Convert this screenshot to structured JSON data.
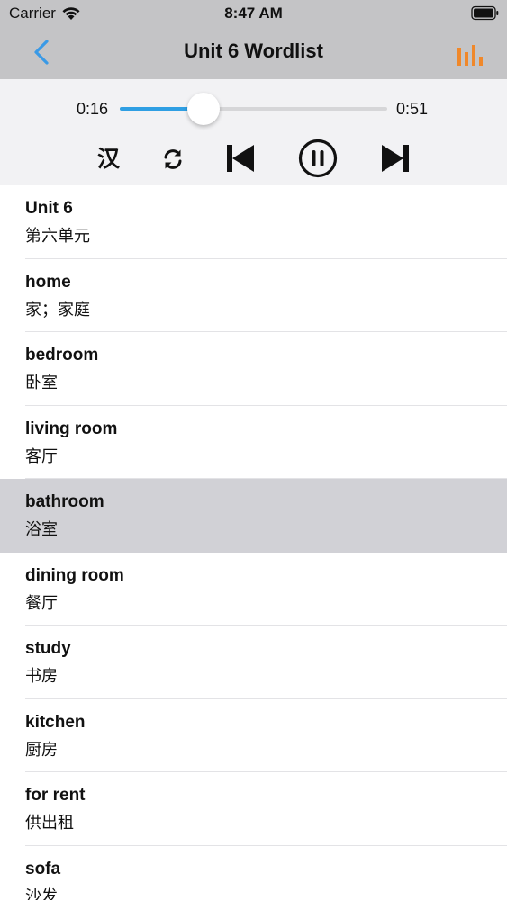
{
  "status_bar": {
    "carrier": "Carrier",
    "time": "8:47 AM",
    "icons": [
      "wifi-icon",
      "battery-icon"
    ]
  },
  "nav": {
    "title": "Unit 6 Wordlist",
    "back_icon": "chevron-left-icon",
    "right_icon": "bar-chart-icon",
    "accent_color": "#3a9ae6",
    "chart_icon_color": "#f0882a"
  },
  "player": {
    "elapsed": "0:16",
    "total": "0:51",
    "progress_fraction": 0.3137,
    "controls": {
      "han_label": "汉",
      "repeat_icon": "repeat-icon",
      "prev_icon": "skip-back-icon",
      "pause_icon": "pause-circle-icon",
      "next_icon": "skip-forward-icon"
    },
    "track_color": "#2f9fe3"
  },
  "words": [
    {
      "en": "Unit 6",
      "zh": "第六单元"
    },
    {
      "en": "home",
      "zh": "家；家庭"
    },
    {
      "en": "bedroom",
      "zh": "卧室"
    },
    {
      "en": "living room",
      "zh": "客厅"
    },
    {
      "en": "bathroom",
      "zh": "浴室"
    },
    {
      "en": "dining room",
      "zh": "餐厅"
    },
    {
      "en": "study",
      "zh": "书房"
    },
    {
      "en": "kitchen",
      "zh": "厨房"
    },
    {
      "en": "for rent",
      "zh": "供出租"
    },
    {
      "en": "sofa",
      "zh": "沙发"
    }
  ],
  "selected_index": 4
}
